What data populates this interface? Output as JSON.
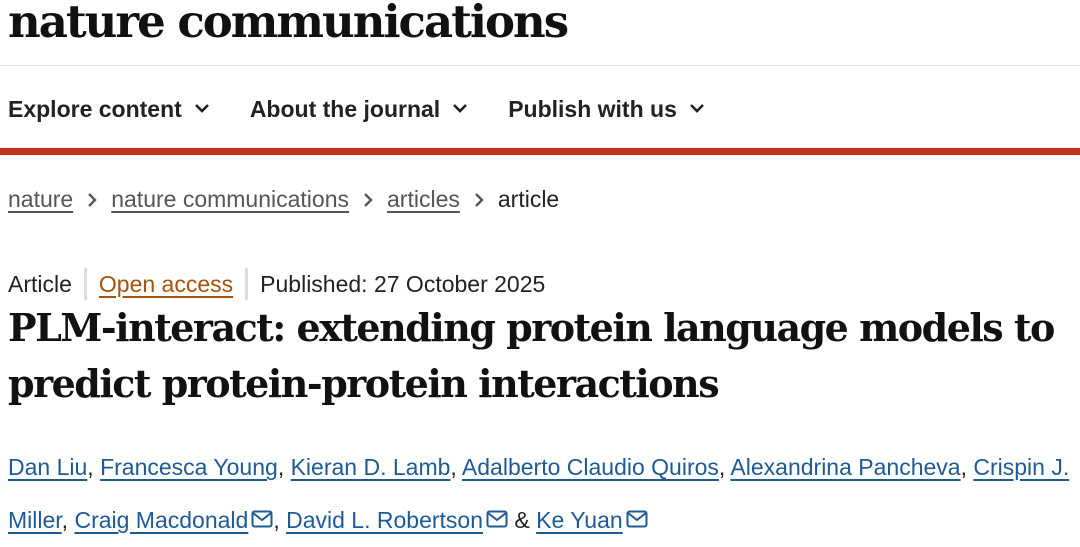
{
  "site": {
    "logo": "nature communications"
  },
  "nav": {
    "items": [
      {
        "label": "Explore content"
      },
      {
        "label": "About the journal"
      },
      {
        "label": "Publish with us"
      }
    ]
  },
  "breadcrumb": {
    "items": [
      "nature",
      "nature communications",
      "articles"
    ],
    "current": "article"
  },
  "article": {
    "type": "Article",
    "access": "Open access",
    "published": "Published: 27 October 2025",
    "title": "PLM-interact: extending protein language models to predict protein-protein interactions",
    "authors": [
      "Dan Liu",
      "Francesca Young",
      "Kieran D. Lamb",
      "Adalberto Claudio Quiros",
      "Alexandrina Pancheva",
      "Crispin J. Miller",
      "Craig Macdonald",
      "David L. Robertson",
      "Ke Yuan"
    ],
    "and_symbol": "&"
  },
  "colors": {
    "accent_bar": "#c0341d",
    "author_link": "#1e5a96",
    "open_access": "#a6520b"
  },
  "icons": {
    "nav_dropdown": "chevron-down-icon",
    "breadcrumb_separator": "chevron-right-icon",
    "author_contact": "mail-icon"
  }
}
